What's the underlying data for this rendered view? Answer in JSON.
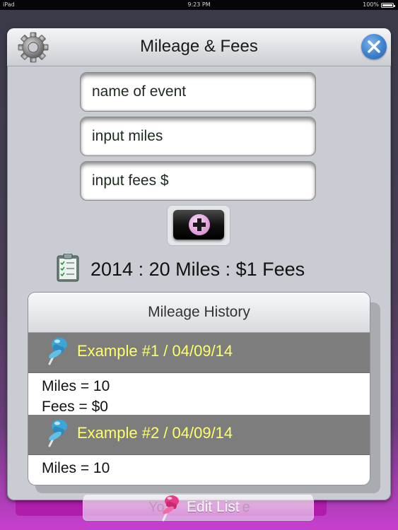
{
  "status_bar": {
    "device": "iPad",
    "time": "9:23 PM",
    "battery": "100%",
    "battery_level": 1.0
  },
  "header": {
    "title": "Mileage & Fees",
    "settings_icon": "gear-icon",
    "close_icon": "close-icon"
  },
  "form": {
    "event_placeholder": "name of event",
    "miles_placeholder": "input miles",
    "fees_placeholder": "input fees $",
    "add_icon": "plus-icon"
  },
  "summary": {
    "icon": "clipboard-checklist-icon",
    "text": "2014 : 20 Miles : $1 Fees"
  },
  "history": {
    "title": "Mileage History",
    "entries": [
      {
        "title": "Example #1 / 04/09/14",
        "miles": "Miles = 10",
        "fees": "Fees = $0"
      },
      {
        "title": "Example #2 / 04/09/14",
        "miles": "Miles = 10",
        "fees": ""
      }
    ]
  },
  "footer": {
    "ghost_text": "Yo",
    "ghost_text_right": "e",
    "edit_label": "Edit List",
    "icon": "pushpin-icon"
  },
  "colors": {
    "accent_blue": "#3d82cf",
    "entry_title": "#ffff66",
    "entry_header_bg": "#7d7d7d",
    "panel_bg": "#c9ccd2",
    "bottom_pink": "#b01aa8"
  }
}
